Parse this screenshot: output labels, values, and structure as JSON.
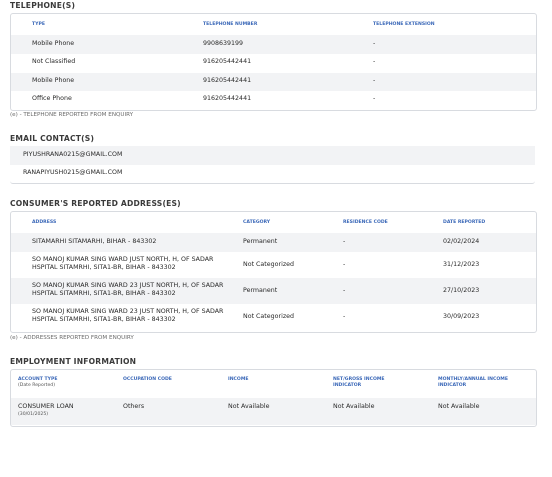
{
  "telephone": {
    "title": "TELEPHONE(S)",
    "headers": [
      "TYPE",
      "TELEPHONE NUMBER",
      "TELEPHONE EXTENSION"
    ],
    "rows": [
      [
        "Mobile Phone",
        "9908639199",
        "-"
      ],
      [
        "Not Classified",
        "916205442441",
        "-"
      ],
      [
        "Mobile Phone",
        "916205442441",
        "-"
      ],
      [
        "Office Phone",
        "916205442441",
        "-"
      ]
    ],
    "note": "(e) - TELEPHONE REPORTED FROM ENQUIRY"
  },
  "email": {
    "title": "EMAIL CONTACT(S)",
    "rows": [
      "PIYUSHRANA0215@GMAIL.COM",
      "RANAPIYUSH0215@GMAIL.COM"
    ]
  },
  "address": {
    "title": "CONSUMER'S REPORTED ADDRESS(ES)",
    "headers": [
      "ADDRESS",
      "CATEGORY",
      "RESIDENCE CODE",
      "DATE REPORTED"
    ],
    "rows": [
      [
        "SITAMARHI SITAMARHI, BIHAR - 843302",
        "Permanent",
        "-",
        "02/02/2024"
      ],
      [
        "SO MANOJ KUMAR SING WARD JUST NORTH, H, OF SADAR HSPITAL SITAMRHI, SITA1-BR, BIHAR - 843302",
        "Not Categorized",
        "-",
        "31/12/2023"
      ],
      [
        "SO MANOJ KUMAR SING WARD 23 JUST NORTH, H, OF SADAR HSPITAL SITAMRHI, SITA1-BR, BIHAR - 843302",
        "Permanent",
        "-",
        "27/10/2023"
      ],
      [
        "SO MANOJ KUMAR SING WARD 23 JUST NORTH, H, OF SADAR HSPITAL SITAMRHI, SITA1-BR, BIHAR - 843302",
        "Not Categorized",
        "-",
        "30/09/2023"
      ]
    ],
    "note": "(e) - ADDRESSES REPORTED FROM ENQUIRY"
  },
  "employment": {
    "title": "EMPLOYMENT INFORMATION",
    "headers": [
      "ACCOUNT TYPE",
      "OCCUPATION CODE",
      "INCOME",
      "NET/GROSS INCOME INDICATOR",
      "MONTHLY/ANNUAL INCOME INDICATOR"
    ],
    "header_sub": "(Date Reported)",
    "row": {
      "account_type": "CONSUMER LOAN",
      "date": "(30/01/2025)",
      "occupation": "Others",
      "income": "Not Available",
      "net_gross": "Not Available",
      "monthly_annual": "Not Available"
    }
  },
  "colors": {
    "header_blue": "#3b68b8",
    "row_alt": "#f2f3f5",
    "border": "#d8dbe0"
  }
}
